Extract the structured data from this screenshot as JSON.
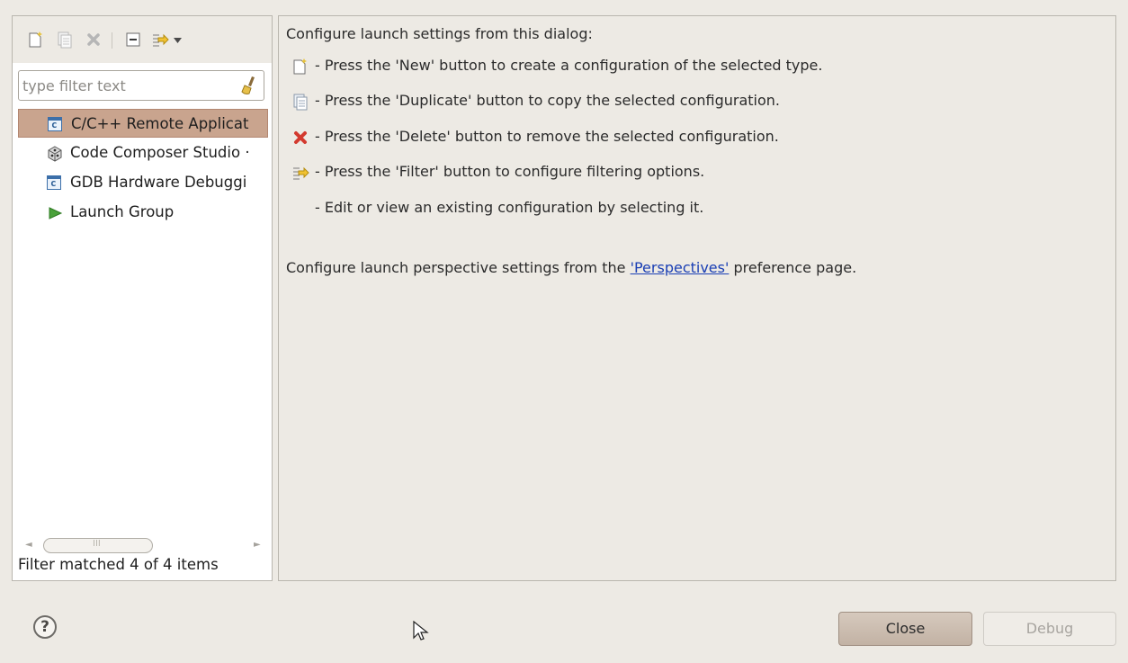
{
  "toolbar": {
    "icons": [
      "new-config-icon",
      "duplicate-icon",
      "delete-icon",
      "collapse-all-icon",
      "filter-icon",
      "dropdown-arrow-icon"
    ]
  },
  "filter": {
    "placeholder": "type filter text",
    "value": ""
  },
  "tree": {
    "items": [
      {
        "label": "C/C++ Remote Applicat",
        "icon": "c-file-icon",
        "selected": true
      },
      {
        "label": "Code Composer Studio ·",
        "icon": "ccs-cube-icon",
        "selected": false
      },
      {
        "label": "GDB Hardware Debuggi",
        "icon": "c-file-icon",
        "selected": false
      },
      {
        "label": "Launch Group",
        "icon": "launch-group-icon",
        "selected": false
      }
    ]
  },
  "status": "Filter matched 4 of 4 items",
  "content": {
    "intro": "Configure launch settings from this dialog:",
    "hints": [
      {
        "icon": "new-config-icon",
        "text": "- Press the 'New' button to create a configuration of the selected type."
      },
      {
        "icon": "duplicate-icon",
        "text": "- Press the 'Duplicate' button to copy the selected configuration."
      },
      {
        "icon": "delete-icon",
        "text": "- Press the 'Delete' button to remove the selected configuration."
      },
      {
        "icon": "filter-icon",
        "text": "- Press the 'Filter' button to configure filtering options."
      },
      {
        "icon": "",
        "text": "- Edit or view an existing configuration by selecting it."
      }
    ],
    "perspective_prefix": "Configure launch perspective settings from the ",
    "perspective_link": "'Perspectives'",
    "perspective_suffix": " preference page."
  },
  "buttons": {
    "close": "Close",
    "debug": "Debug"
  },
  "help_glyph": "?"
}
